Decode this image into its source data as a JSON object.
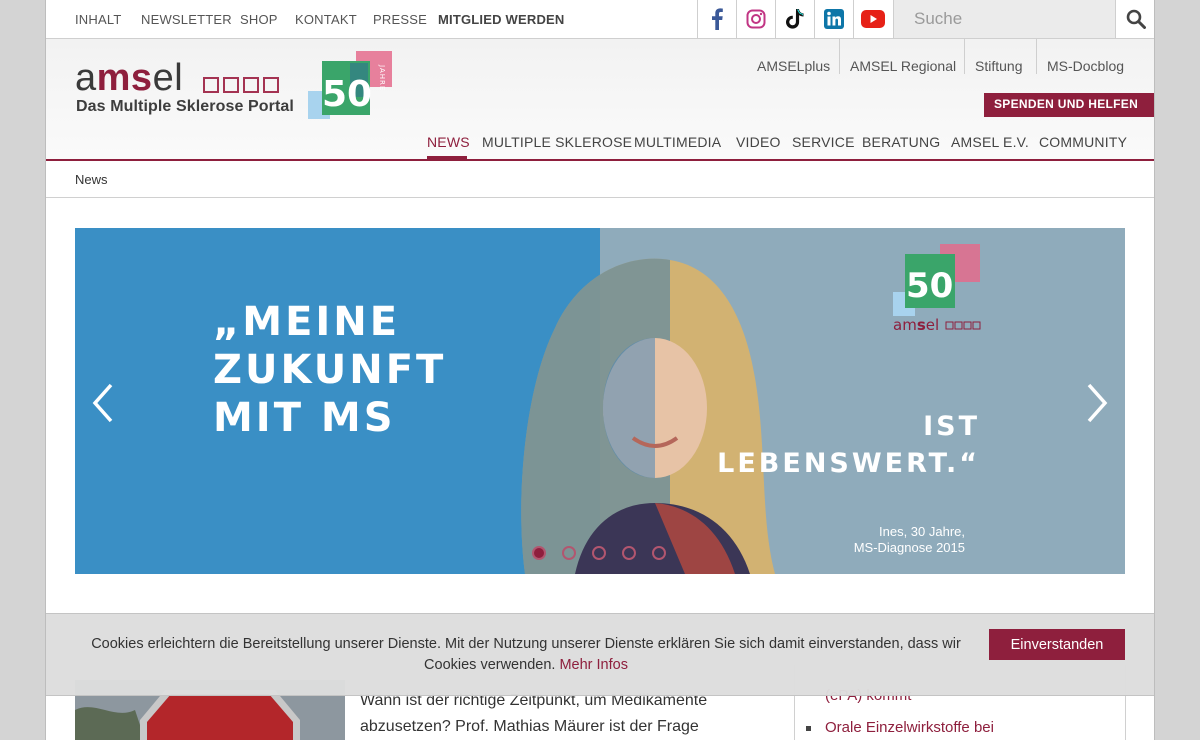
{
  "topbar": {
    "links": [
      "INHALT",
      "NEWSLETTER",
      "SHOP",
      "KONTAKT",
      "PRESSE"
    ],
    "member_link": "MITGLIED WERDEN",
    "search_placeholder": "Suche"
  },
  "social_icons": [
    "facebook-icon",
    "instagram-icon",
    "tiktok-icon",
    "linkedin-icon",
    "youtube-icon"
  ],
  "colors": {
    "brand": "#8e1f3d",
    "slide_left": "#3a8fc5",
    "slide_right": "#8fabbb",
    "badge_green": "#3aa56a",
    "badge_pink": "#e46b8c",
    "badge_lightblue": "#a8d3ee"
  },
  "logo": {
    "word_light": "a",
    "word_bold": "ms",
    "word_end": "el",
    "subtitle": "Das Multiple Sklerose Portal",
    "badge_number": "50",
    "badge_label": "JAHRE"
  },
  "header": {
    "service_links": [
      "AMSELplus",
      "AMSEL Regional",
      "Stiftung",
      "MS-Docblog"
    ],
    "donate": "SPENDEN UND HELFEN"
  },
  "mainnav": [
    "NEWS",
    "MULTIPLE SKLEROSE",
    "MULTIMEDIA",
    "VIDEO",
    "SERVICE",
    "BERATUNG",
    "AMSEL E.V.",
    "COMMUNITY"
  ],
  "mainnav_active": "NEWS",
  "breadcrumb": "News",
  "slider": {
    "quote_left": "„MEINE\nZUKUNFT\nMIT MS",
    "quote_right": "IST\nLEBENSWERT.“",
    "caption_line1": "Ines, 30 Jahre,",
    "caption_line2": "MS-Diagnose 2015",
    "badge_number": "50",
    "badge_brand_light": "am",
    "badge_brand_bold": "s",
    "badge_brand_end": "el",
    "dot_count": 5,
    "active_dot": 1
  },
  "article": {
    "text_line1": "Wann ist der richtige Zeitpunkt, um Medikamente",
    "text_line2": "abzusetzen? Prof. Mathias Mäurer ist der Frage"
  },
  "sidebar": {
    "item_partial": "(ePA) kommt",
    "item_next": "Orale Einzelwirkstoffe bei"
  },
  "cookie": {
    "text": "Cookies erleichtern die Bereitstellung unserer Dienste. Mit der Nutzung unserer Dienste erklären Sie sich damit einverstanden, dass wir Cookies verwenden.",
    "more": "Mehr Infos",
    "accept": "Einverstanden"
  }
}
